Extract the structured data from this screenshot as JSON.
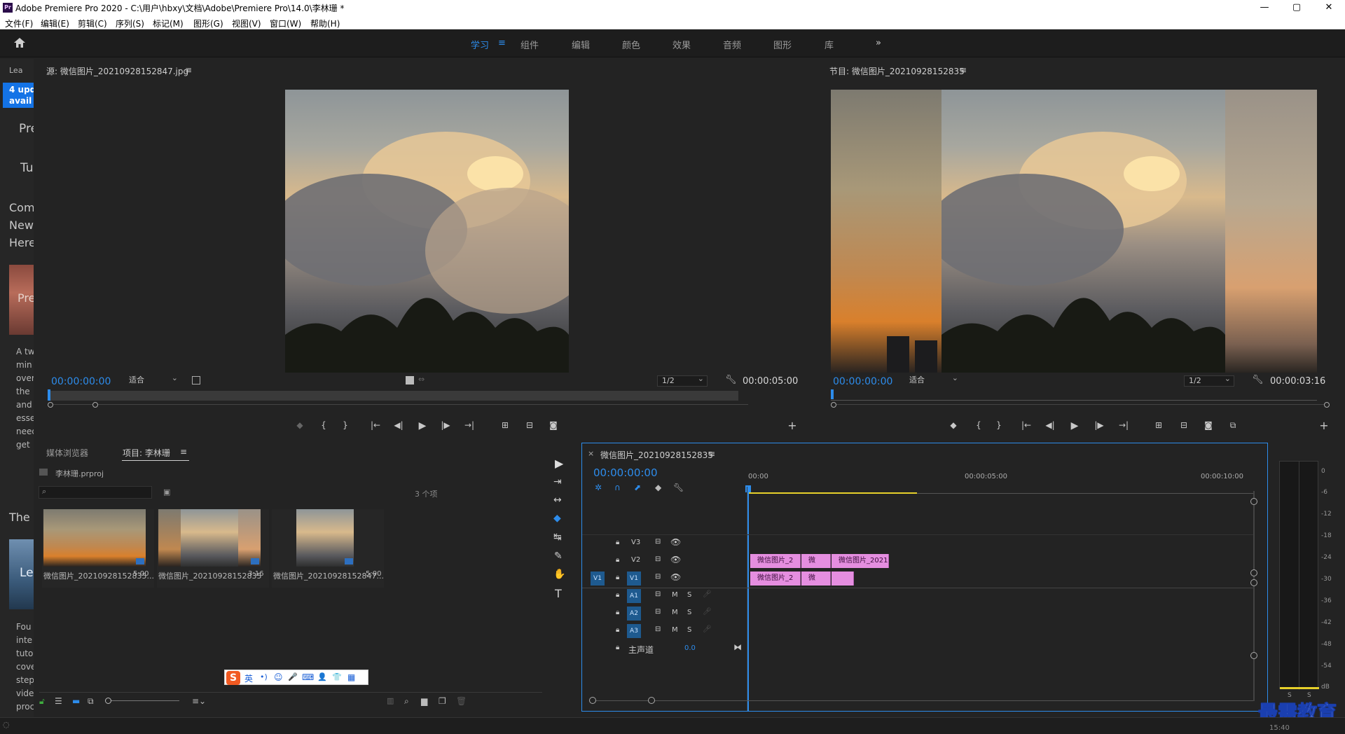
{
  "window": {
    "title": "Adobe Premiere Pro 2020 - C:\\用户\\hbxy\\文档\\Adobe\\Premiere Pro\\14.0\\李林珊 *",
    "app_icon": "Pr",
    "minimize": "—",
    "restore": "▢",
    "close": "✕"
  },
  "menu": [
    "文件(F)",
    "编辑(E)",
    "剪辑(C)",
    "序列(S)",
    "标记(M)",
    "图形(G)",
    "视图(V)",
    "窗口(W)",
    "帮助(H)"
  ],
  "workspace": {
    "tabs": [
      "学习",
      "组件",
      "编辑",
      "颜色",
      "效果",
      "音频",
      "图形",
      "库"
    ],
    "active_menu_icon": "≡",
    "more": "»"
  },
  "learn_panel": {
    "tab": "Lea",
    "banner": [
      "4 upd",
      "avail"
    ],
    "items": [
      "Pre",
      "Tu",
      "Com",
      "New",
      "Here",
      "Pre",
      "A tw",
      "min",
      "over",
      "the",
      "and",
      "esse",
      "need",
      "get",
      "The",
      "Le",
      "Fou",
      "inte",
      "tuto",
      "cove",
      "step",
      "vide",
      "proc"
    ]
  },
  "source_monitor": {
    "title": "源: 微信图片_20210928152847.jpg",
    "menu": "≡",
    "timecode": "00:00:00:00",
    "fit": "适合",
    "resolution": "1/2",
    "duration": "00:00:05:00"
  },
  "program_monitor": {
    "title": "节目: 微信图片_20210928152835",
    "menu": "≡",
    "timecode": "00:00:00:00",
    "fit": "适合",
    "resolution": "1/2",
    "duration": "00:00:03:16"
  },
  "transport": {
    "marker": "◆",
    "in": "{",
    "out": "}",
    "go_in": "|←",
    "step_back": "◀|",
    "play": "▶",
    "step_fwd": "|▶",
    "go_out": "→|",
    "insert": "⊞",
    "overwrite": "⊟",
    "export_frame": "◙",
    "compare": "⧉",
    "add": "+"
  },
  "project_panel": {
    "tab_media": "媒体浏览器",
    "tab_project": "项目: 李林珊",
    "menu": "≡",
    "project_file": "李林珊.prproj",
    "item_count": "3 个项",
    "search_placeholder": "",
    "items": [
      {
        "name": "微信图片_20210928152835...",
        "duration": "5:00"
      },
      {
        "name": "微信图片_20210928152835",
        "duration": "3:16"
      },
      {
        "name": "微信图片_20210928152847...",
        "duration": "5:00"
      }
    ]
  },
  "ime_bar": {
    "logo": "S",
    "lang": "英",
    "items": [
      "•)",
      "☺",
      "🎤",
      "⌨",
      "👤",
      "👕",
      "▦"
    ]
  },
  "tools": [
    "▶",
    "⇥",
    "↔",
    "◆",
    "↹",
    "✎",
    "✋",
    "T"
  ],
  "timeline": {
    "close": "×",
    "title": "微信图片_20210928152835",
    "menu": "≡",
    "timecode": "00:00:00:00",
    "ruler": [
      "00:00",
      "00:00:05:00",
      "00:00:10:00"
    ],
    "tracks": [
      {
        "name": "V3",
        "target": ""
      },
      {
        "name": "V2",
        "target": ""
      },
      {
        "name": "V1",
        "target": "V1"
      },
      {
        "name": "A1",
        "target": "",
        "m": "M",
        "s": "S"
      },
      {
        "name": "A2",
        "target": "",
        "m": "M",
        "s": "S"
      },
      {
        "name": "A3",
        "target": "",
        "m": "M",
        "s": "S"
      }
    ],
    "master": {
      "label": "主声道",
      "value": "0.0"
    },
    "clips_v2": [
      "微信图片_2",
      "微",
      "微信图片_2021"
    ],
    "clips_v1": [
      "微信图片_2",
      "微",
      ""
    ]
  },
  "audio_meter": {
    "scale": [
      "0",
      "-6",
      "-12",
      "-18",
      "-24",
      "-30",
      "-36",
      "-42",
      "-48",
      "-54",
      "dB"
    ],
    "solo": [
      "S",
      "S"
    ]
  },
  "watermark": "最需教育",
  "status": {
    "clock": "15:40"
  }
}
